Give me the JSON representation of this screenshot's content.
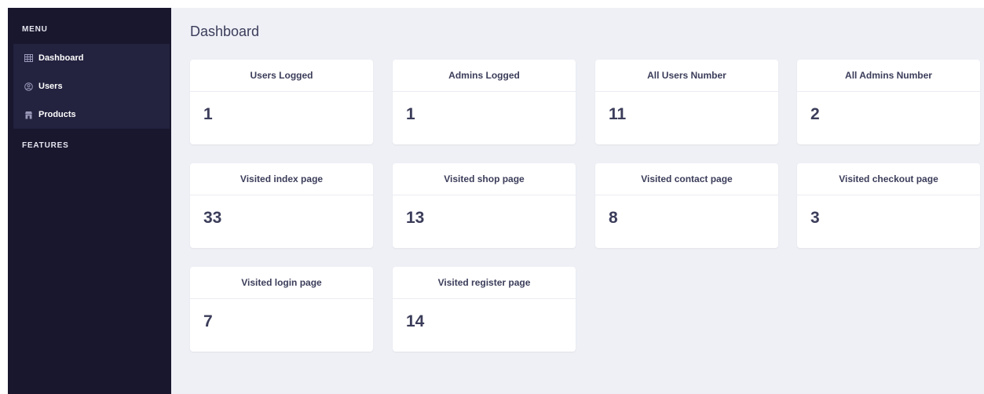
{
  "sidebar": {
    "menu_label": "MENU",
    "features_label": "FEATURES",
    "items": [
      {
        "label": "Dashboard",
        "icon": "table-icon"
      },
      {
        "label": "Users",
        "icon": "user-icon"
      },
      {
        "label": "Products",
        "icon": "shop-icon"
      }
    ]
  },
  "main": {
    "title": "Dashboard",
    "cards": [
      {
        "title": "Users Logged",
        "value": "1"
      },
      {
        "title": "Admins Logged",
        "value": "1"
      },
      {
        "title": "All Users Number",
        "value": "11"
      },
      {
        "title": "All Admins Number",
        "value": "2"
      },
      {
        "title": "Visited index page",
        "value": "33"
      },
      {
        "title": "Visited shop page",
        "value": "13"
      },
      {
        "title": "Visited contact page",
        "value": "8"
      },
      {
        "title": "Visited checkout page",
        "value": "3"
      },
      {
        "title": "Visited login page",
        "value": "7"
      },
      {
        "title": "Visited register page",
        "value": "14"
      }
    ]
  },
  "colors": {
    "sidebar_bg": "#18172e",
    "active_group_bg": "#23223f",
    "main_bg": "#eff0f6",
    "text_dark": "#3b3d5a"
  }
}
